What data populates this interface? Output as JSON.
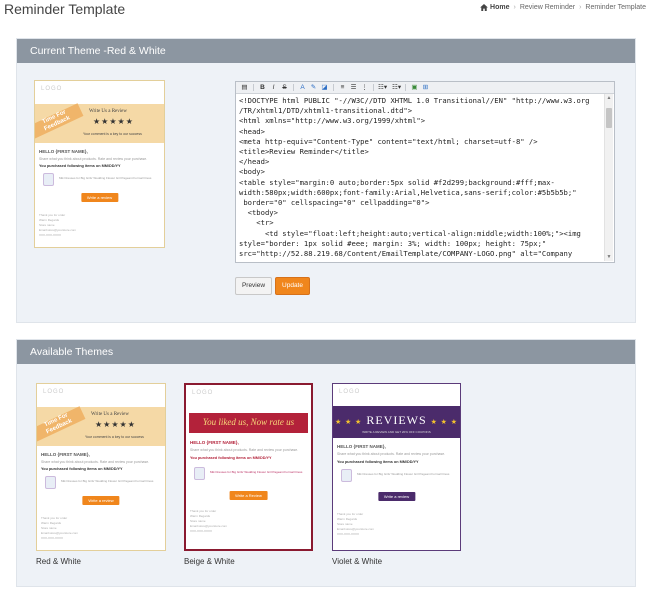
{
  "header": {
    "title": "Reminder Template",
    "breadcrumb": [
      "Home",
      "Review Reminder",
      "Reminder Template"
    ]
  },
  "current_panel": {
    "title": "Current Theme -Red & White",
    "preview_label": "Preview",
    "update_label": "Update",
    "editor_icons": [
      "html-icon",
      "bold-icon",
      "italic-icon",
      "strikethrough-icon",
      "font-icon",
      "font-color-icon",
      "text-bg-icon",
      "align-left-icon",
      "align-center-icon",
      "unordered-list-icon",
      "ordered-list-icon",
      "link-icon",
      "image-icon"
    ],
    "code_lines": [
      "<!DOCTYPE html PUBLIC \"-//W3C//DTD XHTML 1.0 Transitional//EN\" \"http://www.w3.org",
      "/TR/xhtml1/DTD/xhtml1-transitional.dtd\">",
      "<html xmlns=\"http://www.w3.org/1999/xhtml\">",
      "<head>",
      "<meta http-equiv=\"Content-Type\" content=\"text/html; charset=utf-8\" />",
      "<title>Review Reminder</title>",
      "</head>",
      "<body>",
      "<table style=\"margin:0 auto;border:5px solid #f2d299;background:#fff;max-",
      "width:580px;width:600px;font-family:Arial,Helvetica,sans-serif;color:#5b5b5b;\"",
      " border=\"0\" cellspacing=\"0\" cellpadding=\"0\">",
      "  <tbody>",
      "    <tr>",
      "      <td style=\"float:left;height:auto;vertical-align:middle;width:100%;\"><img",
      "style=\"border: 1px solid #eee; margin: 3%; width: 100px; height: 75px;\"",
      "src=\"http://52.88.219.68/Content/EmailTemplate/COMPANY-LOGO.png\" alt=\"Company"
    ]
  },
  "available_panel": {
    "title": "Available Themes",
    "themes": [
      {
        "name": "Red & White"
      },
      {
        "name": "Beige & White"
      },
      {
        "name": "Violet & White"
      }
    ]
  },
  "template_text": {
    "logo": "LOGO",
    "ribbon": "Time For Feedback",
    "write_us": "Write Us a Review",
    "stars": "★★★★★",
    "subline": "Your comment is a key to our success",
    "hello": "HELLO {FIRST NAME},",
    "line1": "Share what you think about products. Rate and review your purchase.",
    "line2": "You purchased following items on MM/DD/YY",
    "product": "Mik Dresses for Big Girls' Wedding Flower Girl Pageant Formal Dress",
    "button": "Write a review",
    "button_beige": "Write a Review",
    "footer": [
      "Thank you for order",
      "Warm Regards",
      "Store name",
      "Email:store@yourstore.com",
      "XXX-XXX-XXXX"
    ],
    "beige_banner": "You liked us, Now rate us",
    "violet_banner": "REVIEWS",
    "violet_stars": "★ ★ ★",
    "violet_sub": "WRITE A REVIEW AND GET 20% OFF COUPONS"
  },
  "colors": {
    "orange": "#f0861c",
    "beige_border": "#8a1a30",
    "violet_border": "#5b3b7a",
    "panel_head": "#8c96a1"
  }
}
